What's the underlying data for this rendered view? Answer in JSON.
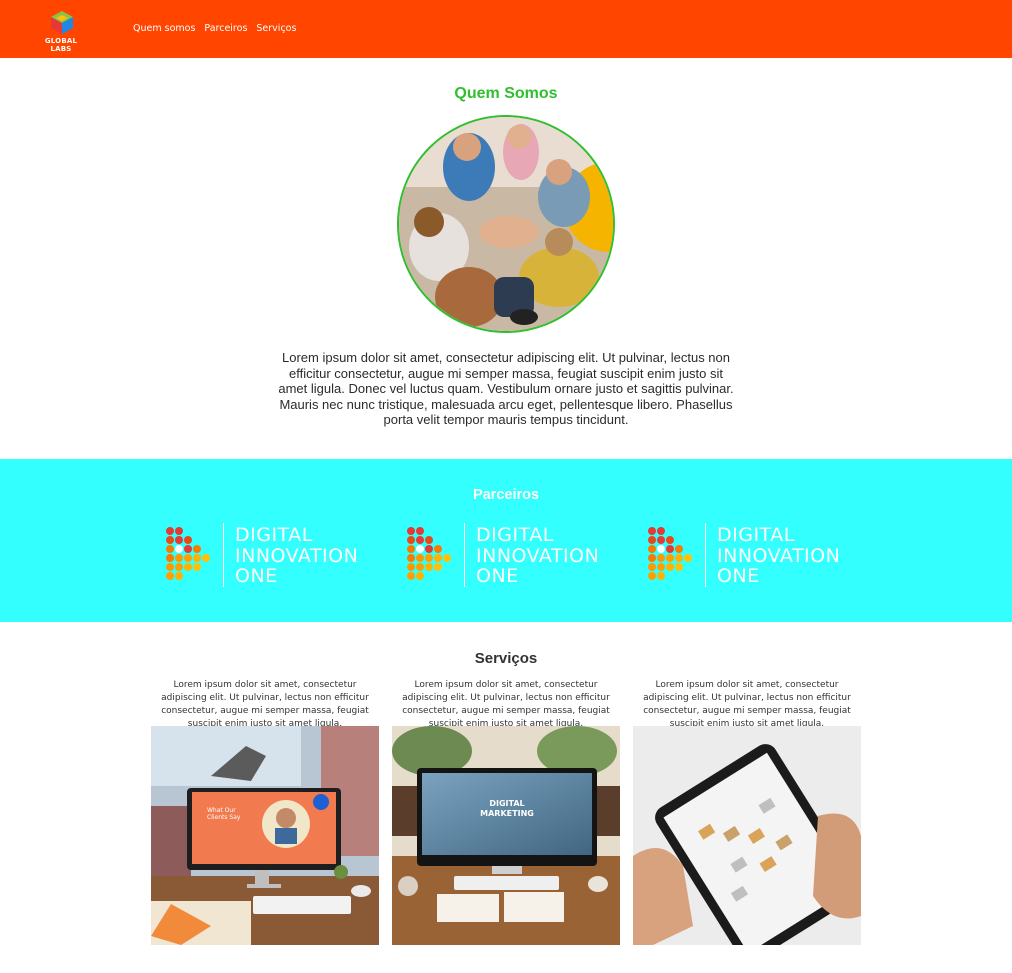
{
  "header": {
    "logo_text": "GLOBAL LABS",
    "nav": [
      "Quem somos",
      "Parceiros",
      "Serviços"
    ],
    "background": "#ff4500"
  },
  "about": {
    "title": "Quem Somos",
    "text": "Lorem ipsum dolor sit amet, consectetur adipiscing elit. Ut pulvinar, lectus non efficitur consectetur, augue mi semper massa, feugiat suscipit enim justo sit amet ligula. Donec vel luctus quam. Vestibulum ornare justo et sagittis pulvinar. Mauris nec nunc tristique, malesuada arcu eget, pellentesque libero. Phasellus porta velit tempor mauris tempus tincidunt.",
    "accent": "#2fbf2f"
  },
  "partners": {
    "title": "Parceiros",
    "background": "#33ffff",
    "logos": [
      {
        "line1": "DIGITAL",
        "line2": "INNOVATION",
        "line3": "ONE"
      },
      {
        "line1": "DIGITAL",
        "line2": "INNOVATION",
        "line3": "ONE"
      },
      {
        "line1": "DIGITAL",
        "line2": "INNOVATION",
        "line3": "ONE"
      }
    ]
  },
  "services": {
    "title": "Serviços",
    "items": [
      {
        "text": "Lorem ipsum dolor sit amet, consectetur adipiscing elit. Ut pulvinar, lectus non efficitur consectetur, augue mi semper massa, feugiat suscipit enim justo sit amet ligula.",
        "screen_line1": "What Our",
        "screen_line2": "Clients Say"
      },
      {
        "text": "Lorem ipsum dolor sit amet, consectetur adipiscing elit. Ut pulvinar, lectus non efficitur consectetur, augue mi semper massa, feugiat suscipit enim justo sit amet ligula.",
        "screen_line1": "DIGITAL",
        "screen_line2": "MARKETING"
      },
      {
        "text": "Lorem ipsum dolor sit amet, consectetur adipiscing elit. Ut pulvinar, lectus non efficitur consectetur, augue mi semper massa, feugiat suscipit enim justo sit amet ligula."
      }
    ]
  }
}
